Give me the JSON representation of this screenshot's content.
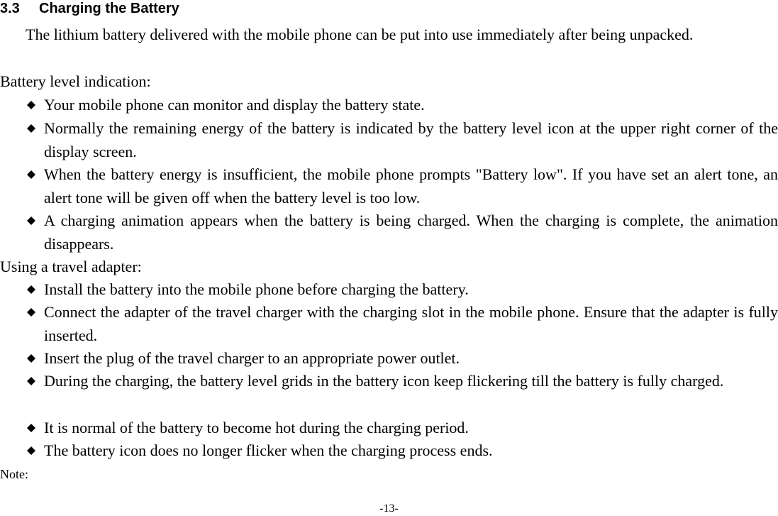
{
  "section": {
    "number": "3.3",
    "title": "Charging the Battery"
  },
  "intro": "The lithium battery delivered with the mobile phone can be put into use immediately after being unpacked.",
  "battery_level": {
    "label": "Battery level indication:",
    "bullets": [
      "Your mobile phone can monitor and display the battery state.",
      "Normally the remaining energy of the battery is indicated by the battery level icon at the upper right corner of the display screen.",
      "When the battery energy is insufficient, the mobile phone prompts \"Battery low\". If you have set an alert tone, an alert tone will be given off when the battery level is too low.",
      "A charging animation appears when the battery is being charged. When the charging is complete, the animation disappears."
    ]
  },
  "travel_adapter": {
    "label": "Using a travel adapter:",
    "bullets": [
      "Install the battery into the mobile phone before charging the battery.",
      "Connect the adapter of the travel charger with the charging slot in the mobile phone. Ensure that the adapter is fully inserted.",
      "Insert the plug of the travel charger to an appropriate power outlet.",
      "During the charging, the battery level grids in the battery icon keep flickering till the battery is fully charged.",
      "It is normal of the battery to become hot during the charging period.",
      "The battery icon does no longer flicker when the charging process ends."
    ]
  },
  "note_label": "Note:",
  "page_number": "-13-",
  "icons": {
    "bullet": "black-diamond"
  }
}
